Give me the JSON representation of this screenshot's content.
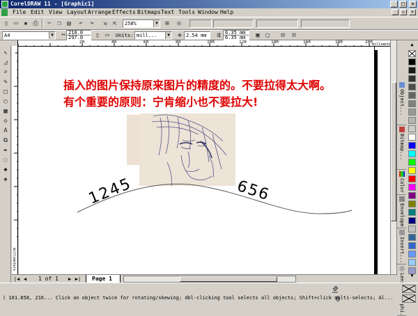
{
  "window": {
    "title": "CorelDRAW 11 - [Graphic1]"
  },
  "menu": [
    "File",
    "Edit",
    "View",
    "Layout",
    "Arrange",
    "Effects",
    "Bitmaps",
    "Text",
    "Tools",
    "Window",
    "Help"
  ],
  "toolbar": {
    "zoom": "258%",
    "paper_size": "A4",
    "width": "210.0",
    "height": "297.0",
    "units_label": "Units:",
    "units_value": "mill...",
    "nudge": "2.54 mm",
    "duplicate_x": "6.35 mm",
    "duplicate_y": "6.35 mm"
  },
  "ruler": {
    "h_labels": [
      "20",
      "40",
      "60",
      "80",
      "100",
      "120",
      "140",
      "160",
      "180",
      "200"
    ],
    "h_units": "millimeters",
    "v_units": "millimeters"
  },
  "canvas": {
    "note_line1": "插入的图片保持原来图片的精度的。不要拉得太大啊。",
    "note_line2": "有个重要的原则：宁肯缩小也不要拉大!",
    "curve_text_left": "1245",
    "curve_text_right": "656"
  },
  "pages": {
    "counter": "1 of 1",
    "tab": "Page 1"
  },
  "dockers": [
    "Object...",
    "Bitmap...",
    "Color",
    "Envelope",
    "Insert...",
    "Lens",
    "Graphi..."
  ],
  "palette": [
    "#000000",
    "#1a1a1a",
    "#333333",
    "#4d4d4d",
    "#666666",
    "#808080",
    "#999999",
    "#b3b3b3",
    "#cccccc",
    "#ffffff",
    "#0000ff",
    "#00ffff",
    "#00ff00",
    "#ffff00",
    "#ff0000",
    "#ff00ff",
    "#800080",
    "#808000",
    "#008080",
    "#000080",
    "#c0c0c0",
    "#336699",
    "#3366cc",
    "#6699ff",
    "#99ccff",
    "#9999cc"
  ],
  "status": {
    "text": "( 101.858, 216... Click an object twice for rotating/skewing; dbl-clicking tool selects all objects; Shift+click multi-selects; Al..."
  }
}
